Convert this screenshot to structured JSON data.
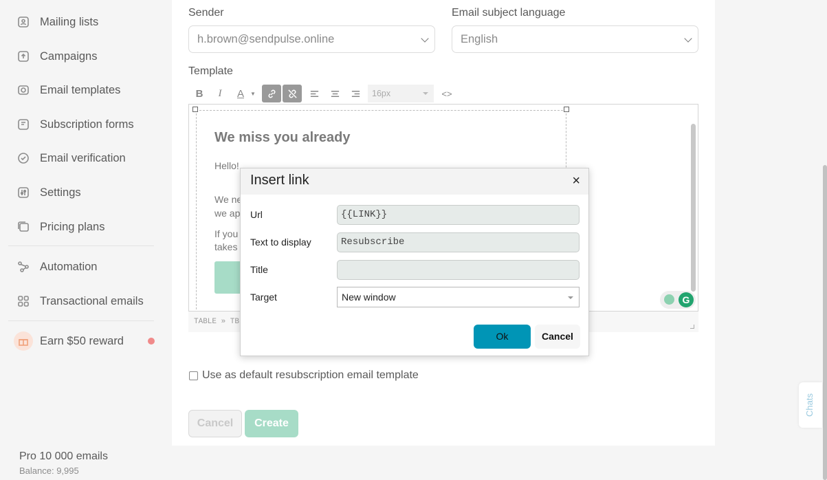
{
  "sidebar": {
    "items": [
      {
        "label": "Mailing lists",
        "icon": "contacts-icon"
      },
      {
        "label": "Campaigns",
        "icon": "campaigns-icon"
      },
      {
        "label": "Email templates",
        "icon": "templates-icon"
      },
      {
        "label": "Subscription forms",
        "icon": "forms-icon"
      },
      {
        "label": "Email verification",
        "icon": "check-circle-icon"
      },
      {
        "label": "Settings",
        "icon": "sliders-icon"
      },
      {
        "label": "Pricing plans",
        "icon": "pricing-icon"
      },
      {
        "label": "Automation",
        "icon": "automation-icon"
      },
      {
        "label": "Transactional emails",
        "icon": "grid-icon"
      }
    ],
    "reward": {
      "label": "Earn $50 reward",
      "icon": "gift-icon"
    },
    "plan": "Pro 10 000 emails",
    "balance": "Balance: 9,995"
  },
  "form": {
    "sender_label": "Sender",
    "sender_value": "h.brown@sendpulse.online",
    "language_label": "Email subject language",
    "language_value": "English",
    "template_label": "Template"
  },
  "toolbar": {
    "bold": "B",
    "italic": "I",
    "color": "A",
    "font_size": "16px",
    "code": "<>"
  },
  "editor": {
    "heading": "We miss you already",
    "greeting": "Hello!",
    "line1": "We ne",
    "line2": "we ap",
    "line3": "If you",
    "line4": "takes",
    "path": "TABLE » TB"
  },
  "default_checkbox_label": "Use as default resubscription email template",
  "buttons": {
    "cancel": "Cancel",
    "create": "Create"
  },
  "chats_label": "Chats",
  "modal": {
    "title": "Insert link",
    "close": "×",
    "url_label": "Url",
    "url_value": "{{LINK}}",
    "text_label": "Text to display",
    "text_value": "Resubscribe",
    "title_label": "Title",
    "title_value": "",
    "target_label": "Target",
    "target_value": "New window",
    "ok": "Ok",
    "cancel": "Cancel"
  },
  "colors": {
    "accent_green": "#a7dcc7",
    "ok_blue": "#0095b6",
    "notification_red": "#f08a8a"
  }
}
